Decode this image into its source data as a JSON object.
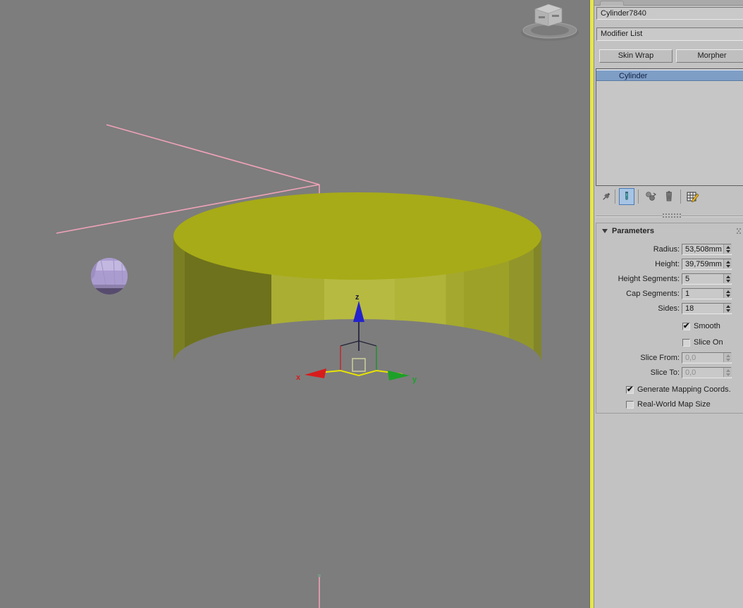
{
  "viewport": {
    "colors": {
      "background": "#7d7d7d",
      "active_border": "#e6e64c",
      "cylinder_top": "#a7ab17",
      "cylinder_side_bright": "#b6ba40",
      "cylinder_side_dark": "#6e721c",
      "sphere": "#ab9cd0",
      "sphere_shadow": "#584c6e",
      "spline": "#f0a2b8",
      "axis_x": "#d81c1c",
      "axis_y": "#1ca028",
      "axis_z": "#2424cc",
      "plane_highlight": "#e8e400"
    },
    "gizmo_labels": {
      "x": "x",
      "y": "y",
      "z": "z"
    }
  },
  "panel": {
    "object_name": "Cylinder7840",
    "modifier_list": "Modifier List",
    "set_buttons": [
      {
        "label": "Skin Wrap"
      },
      {
        "label": "Morpher"
      }
    ],
    "modifier_stack": [
      {
        "label": "Cylinder",
        "selected": true
      }
    ],
    "stack_tools": [
      {
        "name": "pin-stack",
        "active": false
      },
      {
        "name": "show-end-result",
        "active": true
      },
      {
        "name": "make-unique",
        "active": false
      },
      {
        "name": "remove-modifier",
        "active": false
      },
      {
        "name": "configure-modifier-sets",
        "active": false
      }
    ],
    "rollout": {
      "title": "Parameters",
      "spinners": [
        {
          "label": "Radius:",
          "value": "53,508mm",
          "enabled": true
        },
        {
          "label": "Height:",
          "value": "39,759mm",
          "enabled": true
        },
        {
          "label": "Height Segments:",
          "value": "5",
          "enabled": true
        },
        {
          "label": "Cap Segments:",
          "value": "1",
          "enabled": true
        },
        {
          "label": "Sides:",
          "value": "18",
          "enabled": true
        },
        {
          "label": "Slice From:",
          "value": "0,0",
          "enabled": false
        },
        {
          "label": "Slice To:",
          "value": "0,0",
          "enabled": false
        }
      ],
      "checkboxes": [
        {
          "label": "Smooth",
          "checked": true
        },
        {
          "label": "Slice On",
          "checked": false
        },
        {
          "label": "Generate Mapping Coords.",
          "checked": true
        },
        {
          "label": "Real-World Map Size",
          "checked": false
        }
      ]
    }
  },
  "glyphs": {
    "check": "✔"
  }
}
